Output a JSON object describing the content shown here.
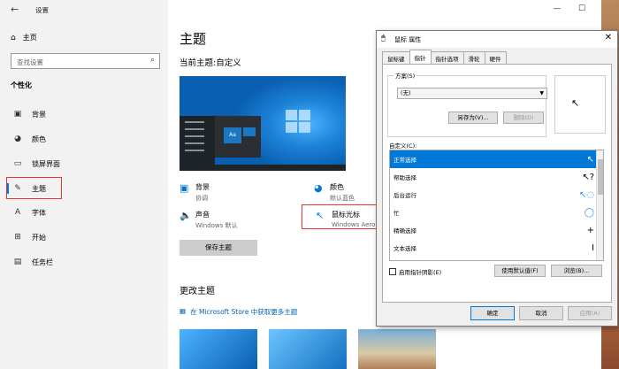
{
  "window": {
    "title": "设置",
    "controls": [
      "—",
      "☐",
      "✕"
    ]
  },
  "sidebar": {
    "home": "主页",
    "search_placeholder": "查找设置",
    "section": "个性化",
    "items": [
      {
        "label": "背景",
        "icon": "picture-icon"
      },
      {
        "label": "颜色",
        "icon": "palette-icon"
      },
      {
        "label": "锁屏界面",
        "icon": "monitor-icon"
      },
      {
        "label": "主题",
        "icon": "brush-icon",
        "selected": true
      },
      {
        "label": "字体",
        "icon": "font-icon"
      },
      {
        "label": "开始",
        "icon": "start-icon"
      },
      {
        "label": "任务栏",
        "icon": "taskbar-icon"
      }
    ]
  },
  "main": {
    "title": "主题",
    "current_theme": "当前主题:自定义",
    "preview_tile": "Aa",
    "options": {
      "background": {
        "label": "背景",
        "value": "协调"
      },
      "color": {
        "label": "颜色",
        "value": "默认蓝色"
      },
      "sound": {
        "label": "声音",
        "value": "Windows 默认"
      },
      "cursor": {
        "label": "鼠标光标",
        "value": "Windows Aero"
      }
    },
    "save_theme": "保存主题",
    "change_theme": "更改主题",
    "store_link": "在 Microsoft Store 中获取更多主题"
  },
  "dialog": {
    "title": "鼠标 属性",
    "tabs": [
      "鼠标键",
      "指针",
      "指针选项",
      "滑轮",
      "硬件"
    ],
    "active_tab": "指针",
    "scheme_label": "方案(S)",
    "scheme_value": "(无)",
    "save_as": "另存为(V)...",
    "delete": "删除(D)",
    "customize_label": "自定义(C):",
    "cursor_list": [
      "正常选择",
      "帮助选择",
      "后台运行",
      "忙",
      "精确选择",
      "文本选择"
    ],
    "enable_shadow": "启用指针阴影(E)",
    "use_default": "使用默认值(F)",
    "browse": "浏览(B)...",
    "ok": "确定",
    "cancel": "取消",
    "apply": "应用(A)"
  },
  "colors": {
    "accent": "#0078d7",
    "highlight_box": "#e33333"
  }
}
